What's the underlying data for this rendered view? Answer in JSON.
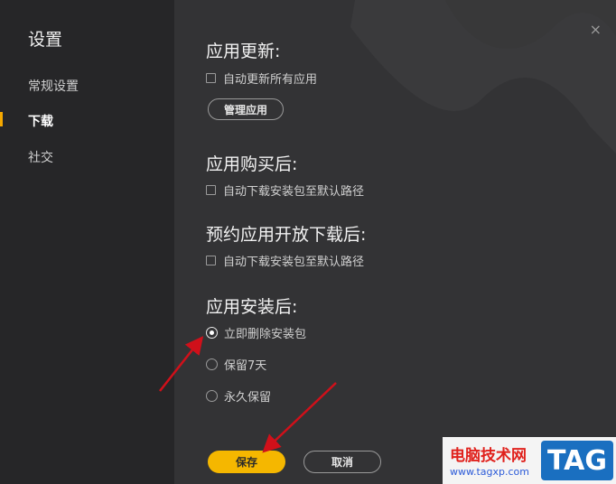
{
  "sidebar": {
    "title": "设置",
    "items": [
      {
        "label": "常规设置"
      },
      {
        "label": "下载",
        "active": true
      },
      {
        "label": "社交"
      }
    ]
  },
  "close_glyph": "×",
  "sections": {
    "update": {
      "title": "应用更新:",
      "checkbox": "自动更新所有应用",
      "button": "管理应用"
    },
    "after_purchase": {
      "title": "应用购买后:",
      "checkbox": "自动下载安装包至默认路径"
    },
    "preorder": {
      "title": "预约应用开放下载后:",
      "checkbox": "自动下载安装包至默认路径"
    },
    "after_install": {
      "title": "应用安装后:",
      "options": [
        {
          "label": "立即删除安装包",
          "selected": true
        },
        {
          "label": "保留7天",
          "selected": false
        },
        {
          "label": "永久保留",
          "selected": false
        }
      ]
    }
  },
  "footer": {
    "save_label": "保存",
    "cancel_label": "取消"
  },
  "watermark": {
    "text": "电脑技术网",
    "url": "www.tagxp.com",
    "tag": "TAG"
  },
  "colors": {
    "accent": "#f5b700",
    "arrow": "#d0101a"
  }
}
